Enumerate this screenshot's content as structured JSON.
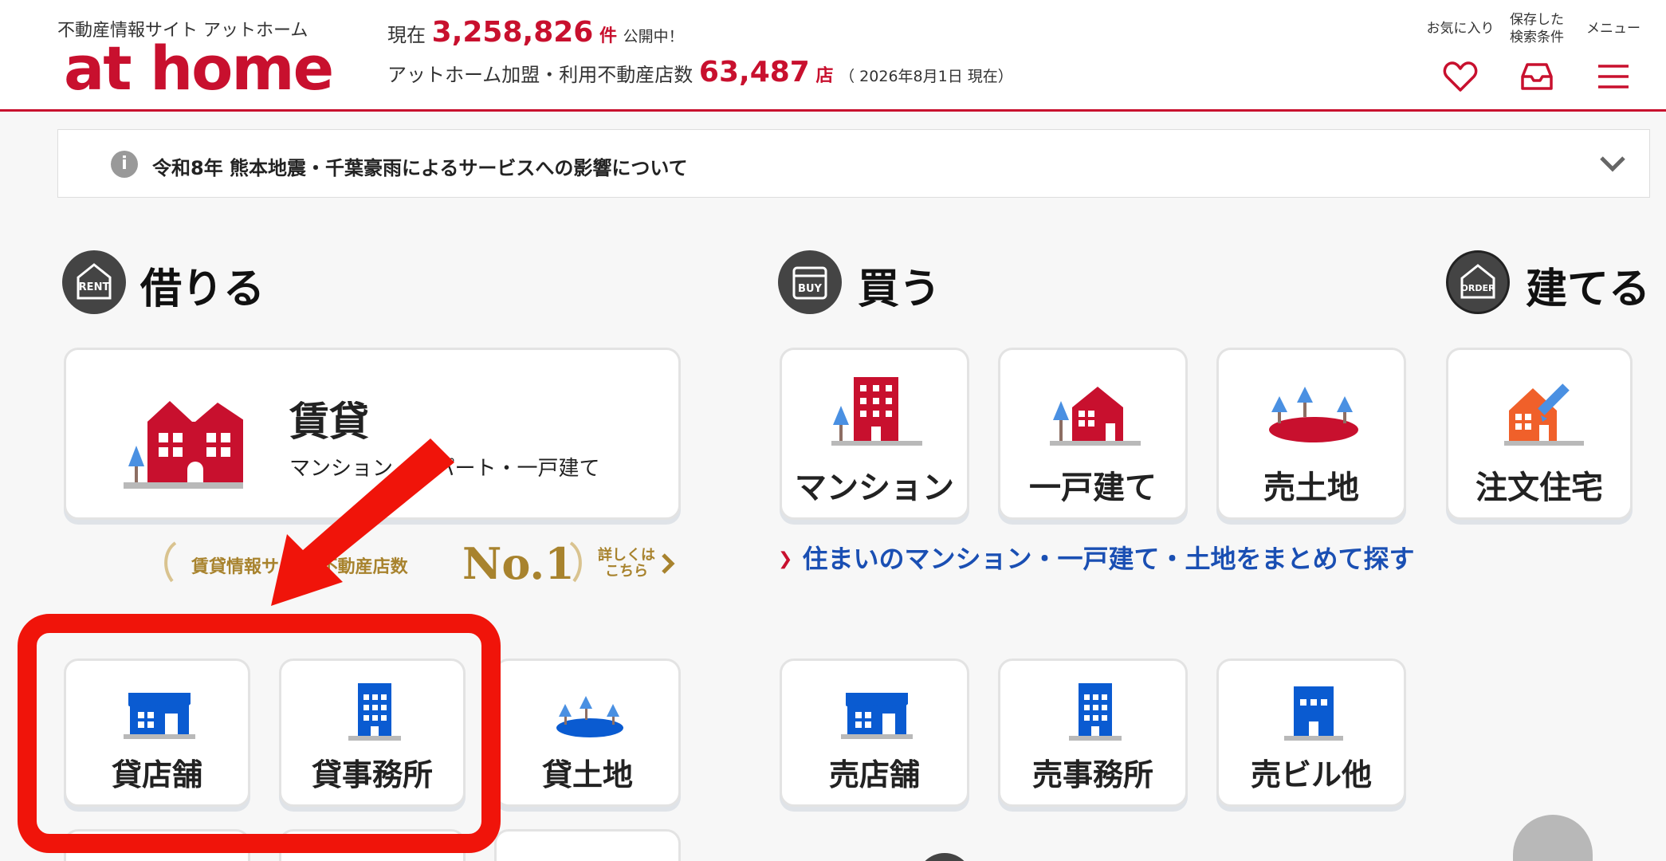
{
  "header": {
    "tagline": "不動産情報サイト アットホーム",
    "logo": "at home",
    "current_label": "現在",
    "listing_count": "3,258,826",
    "listing_unit": "件",
    "listing_suffix": "公開中！",
    "agencies_label": "アットホーム加盟・利用不動産店数",
    "agency_count": "63,487",
    "agency_unit": "店",
    "as_of": "（ 2026年8月1日 現在）",
    "nav": {
      "favorites": "お気に入り",
      "saved_search_line1": "保存した",
      "saved_search_line2": "検索条件",
      "menu": "メニュー"
    }
  },
  "notice": {
    "text": "令和8年 熊本地震・千葉豪雨によるサービスへの影響について"
  },
  "sections": {
    "rent": {
      "badge": "RENT",
      "title": "借りる",
      "main_card_title": "賃貸",
      "main_card_subtitle": "マンション・アパート・一戸建て",
      "promo_text": "賃貸情報サイト 不動産店数",
      "promo_badge": "No.1",
      "promo_more_line1": "詳しくは",
      "promo_more_line2": "こちら",
      "cards": [
        "貸店舗",
        "貸事務所",
        "貸土地"
      ]
    },
    "buy": {
      "badge": "BUY",
      "title": "買う",
      "cards": [
        "マンション",
        "一戸建て",
        "売土地"
      ],
      "link": "住まいのマンション・一戸建て・土地をまとめて探す",
      "biz_cards": [
        "売店舗",
        "売事務所",
        "売ビル他"
      ]
    },
    "build": {
      "badge": "ORDER",
      "title": "建てる",
      "cards": [
        "注文住宅"
      ]
    }
  },
  "colors": {
    "brand_red": "#c8102e",
    "link_blue": "#1a4fb3",
    "icon_blue": "#0a5bd1",
    "highlight": "#f0140a",
    "gold": "#a8832e"
  }
}
